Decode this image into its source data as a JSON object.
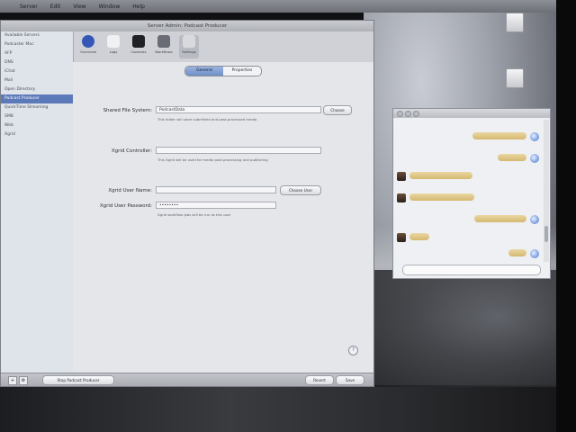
{
  "menubar": {
    "apple": "",
    "items": [
      "Server",
      "Edit",
      "View",
      "Window",
      "Help"
    ]
  },
  "desktop": {
    "icon1_label": "",
    "icon2_label": ""
  },
  "server_window": {
    "title": "Server Admin: Podcast Producer",
    "sidebar": [
      "Available Servers",
      "Podcaster Mac",
      "AFP",
      "DNS",
      "iChat",
      "Mail",
      "Open Directory",
      "Podcast Producer",
      "QuickTime Streaming",
      "SMB",
      "Web",
      "Xgrid"
    ],
    "sidebar_selected_index": 7,
    "toolbar": [
      "Overview",
      "Logs",
      "Cameras",
      "Workflows",
      "Settings"
    ],
    "toolbar_selected_index": 4,
    "tabs": [
      "General",
      "Properties"
    ],
    "tab_selected_index": 0,
    "shared_fs_label": "Shared File System:",
    "shared_fs_value": "PodcastData",
    "shared_fs_hint": "This folder will store submitted and post-processed media",
    "choose_label": "Choose",
    "xgrid_controller_label": "Xgrid Controller:",
    "xgrid_controller_value": "",
    "xgrid_controller_hint": "This Xgrid will be used for media post-processing and publishing",
    "xgrid_user_label": "Xgrid User Name:",
    "xgrid_user_value": "",
    "choose_user_label": "Choose User",
    "xgrid_pass_label": "Xgrid User Password:",
    "xgrid_pass_value": "••••••••",
    "xgrid_pass_hint": "Xgrid workflow jobs will be run as this user",
    "help": "?",
    "bottom_button": "Stop Podcast Producer",
    "revert": "Revert",
    "save": "Save",
    "add": "+",
    "gear": "⚙"
  },
  "chat_window": {
    "title": "",
    "messages": [
      {
        "from": "me",
        "text": ""
      },
      {
        "from": "me",
        "text": ""
      },
      {
        "from": "them",
        "text": ""
      },
      {
        "from": "them",
        "text": ""
      },
      {
        "from": "me",
        "text": ""
      },
      {
        "from": "them",
        "text": ""
      },
      {
        "from": "me",
        "text": ""
      }
    ]
  }
}
